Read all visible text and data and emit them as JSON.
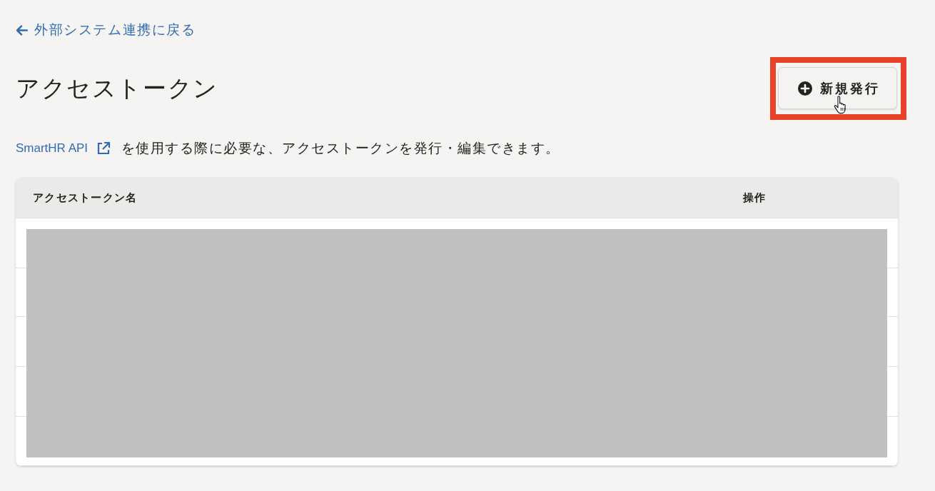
{
  "back_link": {
    "label": "外部システム連携に戻る"
  },
  "header": {
    "title": "アクセストークン",
    "new_button": {
      "label": "新規発行",
      "highlighted": true,
      "hovered": true
    }
  },
  "description": {
    "link": "SmartHR API",
    "text": "を使用する際に必要な、アクセストークンを発行・編集できます。"
  },
  "table": {
    "columns": [
      "アクセストークン名",
      "操作"
    ],
    "body": {
      "redacted": true
    }
  }
}
